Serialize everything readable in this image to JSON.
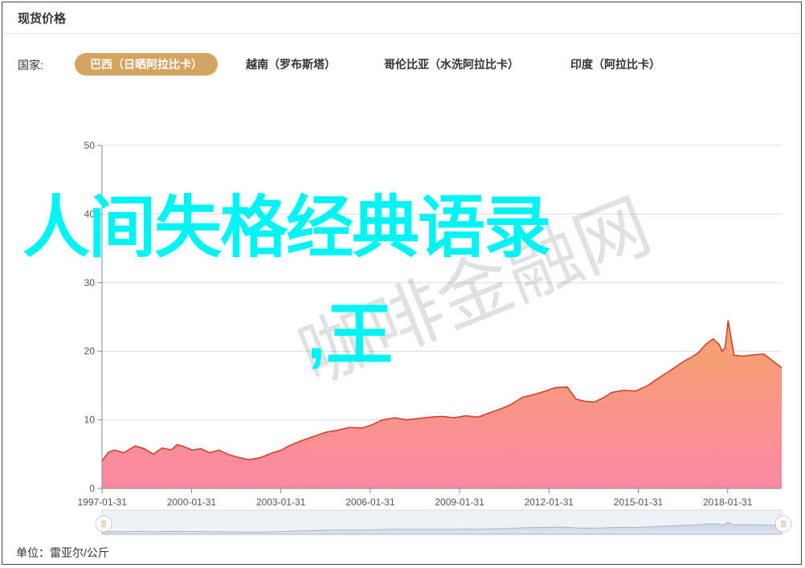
{
  "header": {
    "title": "现货价格"
  },
  "country": {
    "label": "国家:",
    "options": [
      {
        "label": "巴西（日晒阿拉比卡）",
        "active": true
      },
      {
        "label": "越南（罗布斯塔）",
        "active": false
      },
      {
        "label": "哥伦比亚（水洗阿拉比卡）",
        "active": false
      },
      {
        "label": "印度（阿拉比卡）",
        "active": false
      }
    ]
  },
  "unit": "单位：雷亚尔/公斤",
  "overlay": {
    "line1": "人间失格经典语录",
    "line2": ",王"
  },
  "watermark": "咖啡金融网",
  "colors": {
    "accent": "#d4a463",
    "series_line": "#d23a2a",
    "area_top": "#f6a46a",
    "area_bottom": "#fb88a4",
    "overlay_text": "#00f4f4"
  },
  "chart_data": {
    "type": "area",
    "ylim": [
      0,
      50
    ],
    "yticks": [
      "0",
      "10",
      "20",
      "30",
      "40",
      "50"
    ],
    "xticks": [
      "1997-01-31",
      "2000-01-31",
      "2003-01-31",
      "2006-01-31",
      "2009-01-31",
      "2012-01-31",
      "2015-01-31",
      "2018-01-31"
    ],
    "xrange": [
      1997.08,
      2019.9
    ],
    "grid": true,
    "x": [
      1997.08,
      1997.3,
      1997.5,
      1997.8,
      1998.2,
      1998.5,
      1998.8,
      1999.1,
      1999.4,
      1999.6,
      1999.9,
      2000.1,
      2000.4,
      2000.7,
      2001.0,
      2001.3,
      2001.6,
      2002.0,
      2002.4,
      2002.8,
      2003.1,
      2003.4,
      2003.8,
      2004.2,
      2004.6,
      2005.0,
      2005.4,
      2005.8,
      2006.1,
      2006.5,
      2006.9,
      2007.3,
      2007.7,
      2008.1,
      2008.5,
      2008.9,
      2009.3,
      2009.7,
      2010.0,
      2010.4,
      2010.8,
      2011.2,
      2011.5,
      2011.9,
      2012.3,
      2012.7,
      2013.0,
      2013.3,
      2013.6,
      2013.9,
      2014.2,
      2014.6,
      2015.0,
      2015.4,
      2015.8,
      2016.2,
      2016.6,
      2016.9,
      2017.1,
      2017.4,
      2017.6,
      2017.8,
      2017.9,
      2018.0,
      2018.1,
      2018.3,
      2018.6,
      2019.0,
      2019.3,
      2019.6,
      2019.9
    ],
    "y": [
      4.0,
      5.3,
      5.6,
      5.2,
      6.2,
      5.8,
      5.0,
      5.9,
      5.6,
      6.4,
      6.0,
      5.6,
      5.8,
      5.2,
      5.6,
      5.0,
      4.6,
      4.2,
      4.5,
      5.2,
      5.6,
      6.3,
      7.0,
      7.6,
      8.2,
      8.5,
      8.9,
      8.8,
      9.2,
      10.0,
      10.3,
      10.0,
      10.2,
      10.4,
      10.5,
      10.3,
      10.6,
      10.4,
      10.9,
      11.5,
      12.2,
      13.3,
      13.6,
      14.1,
      14.7,
      14.8,
      13.0,
      12.7,
      12.6,
      13.2,
      14.0,
      14.3,
      14.2,
      15.0,
      16.2,
      17.3,
      18.5,
      19.2,
      19.8,
      21.2,
      21.8,
      21.0,
      20.0,
      20.5,
      24.5,
      19.4,
      19.3,
      19.5,
      19.6,
      18.6,
      17.6
    ]
  }
}
